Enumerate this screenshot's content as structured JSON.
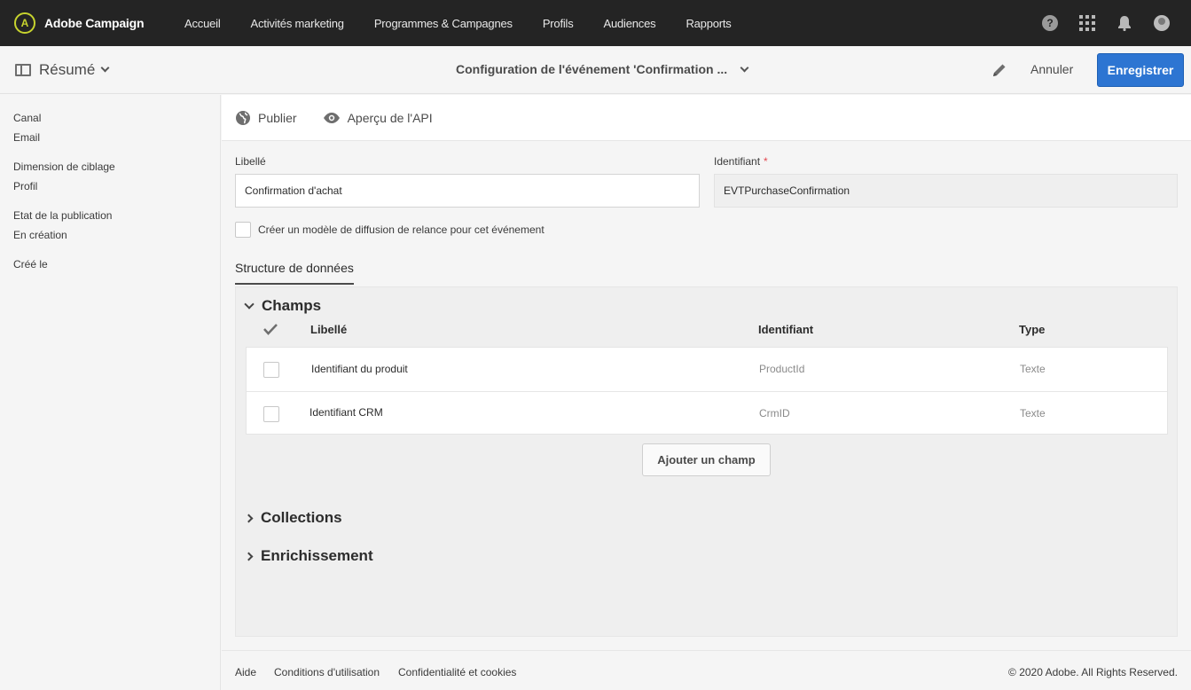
{
  "app": {
    "name": "Adobe Campaign",
    "logo_glyph": "A"
  },
  "nav": [
    "Accueil",
    "Activités marketing",
    "Programmes & Campagnes",
    "Profils",
    "Audiences",
    "Rapports"
  ],
  "top_icons": [
    "help-icon",
    "apps-grid-icon",
    "bell-icon",
    "avatar"
  ],
  "header": {
    "summary_label": "Résumé",
    "title": "Configuration de l'événement 'Confirmation ...",
    "cancel_label": "Annuler",
    "save_label": "Enregistrer"
  },
  "summary": [
    {
      "key": "Canal",
      "value": "Email"
    },
    {
      "key": "Dimension de ciblage",
      "value": "Profil"
    },
    {
      "key": "Etat de la publication",
      "value": "En création"
    },
    {
      "key": "Créé le",
      "value": ""
    }
  ],
  "actions": {
    "publish": "Publier",
    "api_preview": "Aperçu de l'API"
  },
  "form": {
    "label_title": "Libellé",
    "label_value": "Confirmation d'achat",
    "id_title": "Identifiant",
    "id_required": "*",
    "id_value": "EVTPurchaseConfirmation",
    "checkbox_label": "Créer un modèle de diffusion de relance pour cet événement"
  },
  "tabs": {
    "data_structure": "Structure de données"
  },
  "fields": {
    "section_title": "Champs",
    "columns": {
      "label": "Libellé",
      "id": "Identifiant",
      "type": "Type"
    },
    "rows": [
      {
        "label": "Identifiant du produit",
        "id": "ProductId",
        "type": "Texte"
      },
      {
        "label": "Identifiant CRM",
        "id": "CrmID",
        "type": "Texte"
      }
    ],
    "add_button": "Ajouter un champ"
  },
  "sections": {
    "collections": "Collections",
    "enrichment": "Enrichissement"
  },
  "footer": {
    "help": "Aide",
    "terms": "Conditions d'utilisation",
    "privacy": "Confidentialité et cookies",
    "copyright": "© 2020 Adobe. All Rights Reserved."
  },
  "colors": {
    "primary": "#2d75d2",
    "topbar": "#242424",
    "logo_accent": "#c7d32e",
    "required": "#e34850"
  }
}
